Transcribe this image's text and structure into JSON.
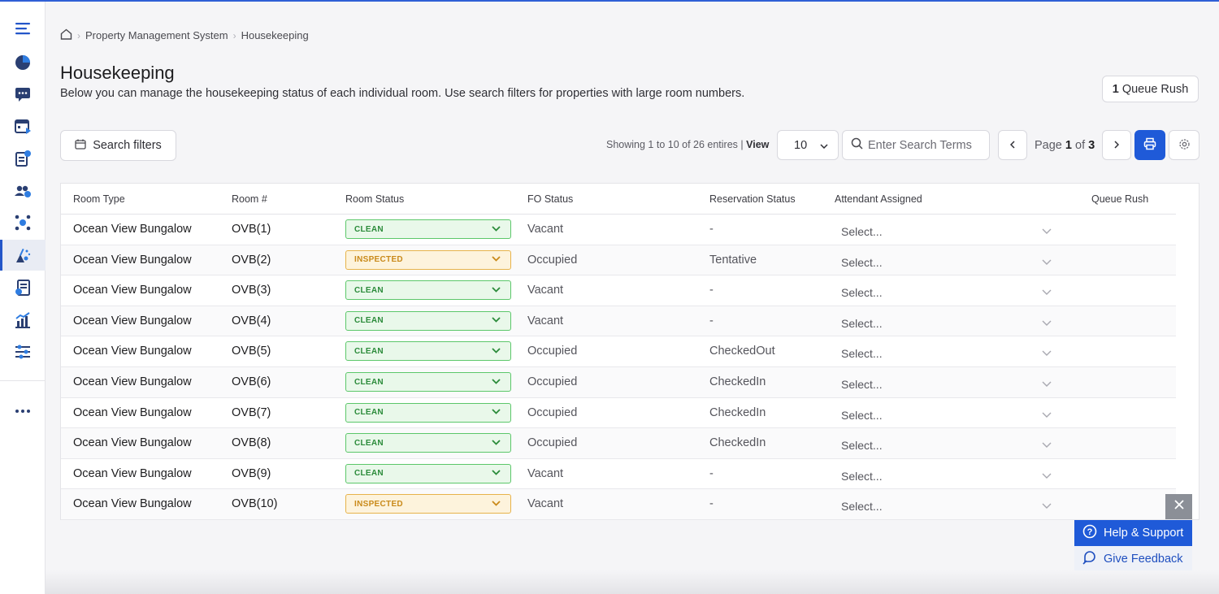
{
  "breadcrumb": {
    "items": [
      "Property Management System",
      "Housekeeping"
    ]
  },
  "page": {
    "title": "Housekeeping",
    "description": "Below you can manage the housekeeping status of each individual room. Use search filters for properties with large room numbers."
  },
  "queue_rush_button": {
    "count": "1",
    "label": "Queue Rush"
  },
  "toolbar": {
    "search_filters_label": "Search filters",
    "showing_text": "Showing 1 to 10 of 26 entires",
    "view_label": "View",
    "view_value": "10",
    "search_placeholder": "Enter Search Terms",
    "page_label": "Page",
    "page_current": "1",
    "page_of": "of",
    "page_total": "3"
  },
  "table": {
    "columns": [
      "Room Type",
      "Room #",
      "Room Status",
      "FO Status",
      "Reservation Status",
      "Attendant Assigned",
      "Queue Rush"
    ],
    "rows": [
      {
        "type": "Ocean View Bungalow",
        "room": "OVB(1)",
        "status": "CLEAN",
        "fo": "Vacant",
        "reservation": "-",
        "attendant": "Select..."
      },
      {
        "type": "Ocean View Bungalow",
        "room": "OVB(2)",
        "status": "INSPECTED",
        "fo": "Occupied",
        "reservation": "Tentative",
        "attendant": "Select..."
      },
      {
        "type": "Ocean View Bungalow",
        "room": "OVB(3)",
        "status": "CLEAN",
        "fo": "Vacant",
        "reservation": "-",
        "attendant": "Select..."
      },
      {
        "type": "Ocean View Bungalow",
        "room": "OVB(4)",
        "status": "CLEAN",
        "fo": "Vacant",
        "reservation": "-",
        "attendant": "Select..."
      },
      {
        "type": "Ocean View Bungalow",
        "room": "OVB(5)",
        "status": "CLEAN",
        "fo": "Occupied",
        "reservation": "CheckedOut",
        "attendant": "Select..."
      },
      {
        "type": "Ocean View Bungalow",
        "room": "OVB(6)",
        "status": "CLEAN",
        "fo": "Occupied",
        "reservation": "CheckedIn",
        "attendant": "Select..."
      },
      {
        "type": "Ocean View Bungalow",
        "room": "OVB(7)",
        "status": "CLEAN",
        "fo": "Occupied",
        "reservation": "CheckedIn",
        "attendant": "Select..."
      },
      {
        "type": "Ocean View Bungalow",
        "room": "OVB(8)",
        "status": "CLEAN",
        "fo": "Occupied",
        "reservation": "CheckedIn",
        "attendant": "Select..."
      },
      {
        "type": "Ocean View Bungalow",
        "room": "OVB(9)",
        "status": "CLEAN",
        "fo": "Vacant",
        "reservation": "-",
        "attendant": "Select..."
      },
      {
        "type": "Ocean View Bungalow",
        "room": "OVB(10)",
        "status": "INSPECTED",
        "fo": "Vacant",
        "reservation": "-",
        "attendant": "Select..."
      }
    ]
  },
  "help": {
    "support_label": "Help & Support",
    "feedback_label": "Give Feedback"
  },
  "sidebar": {
    "icons": [
      "menu-icon",
      "pie-chart-icon",
      "chat-icon",
      "calendar-icon",
      "clipboard-check-icon",
      "guests-icon",
      "network-icon",
      "housekeeping-icon",
      "invoice-icon",
      "reports-icon",
      "settings-sliders-icon",
      "more-icon"
    ],
    "active": "housekeeping-icon"
  },
  "colors": {
    "accent": "#1f5ad8",
    "clean": "#2b8b3a",
    "inspected": "#c98a1a"
  }
}
